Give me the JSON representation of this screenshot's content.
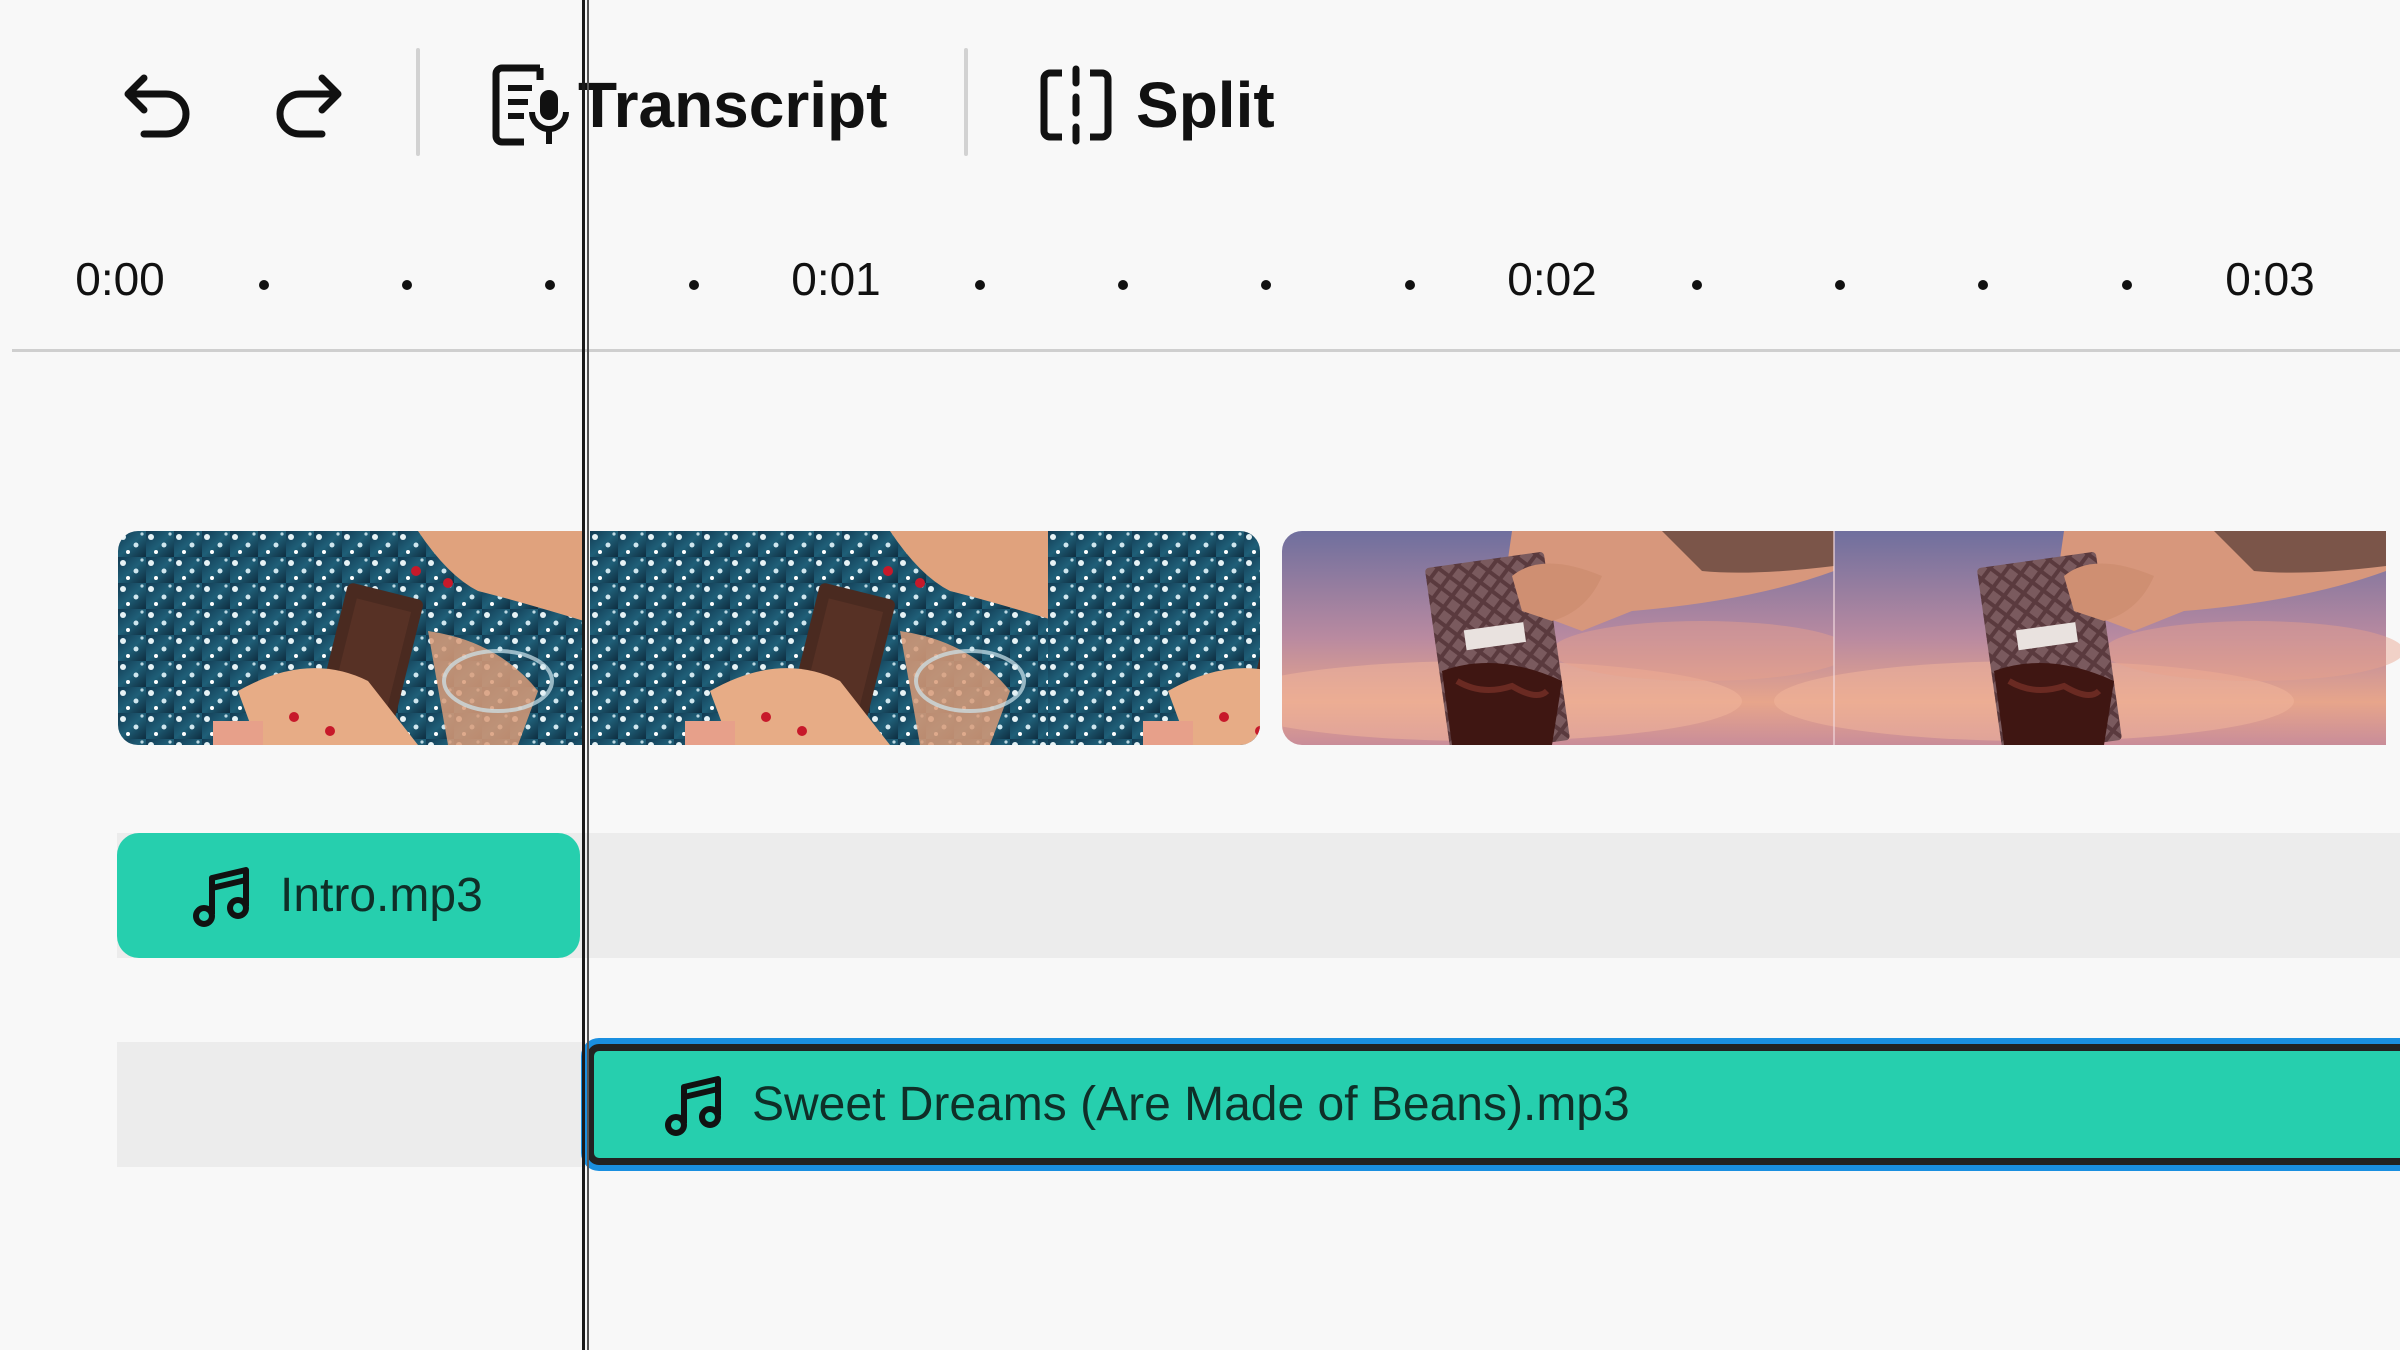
{
  "toolbar": {
    "undo_icon": "undo-icon",
    "redo_icon": "redo-icon",
    "transcript_label": "Transcript",
    "transcript_icon": "transcript-icon",
    "split_label": "Split",
    "split_icon": "split-icon"
  },
  "ruler": {
    "labels": [
      "0:00",
      "0:01",
      "0:02",
      "0:03"
    ]
  },
  "tracks": {
    "video_clips": [
      {
        "name": "jewels-chocolate-clip",
        "scene": "hands holding chocolate bar among jewels"
      },
      {
        "name": "sunset-chocolate-clip",
        "scene": "hand holding Moiré chocolate bar against sunset sky"
      }
    ],
    "audio_intro": {
      "label": "Intro.mp3",
      "icon": "music-note-icon"
    },
    "audio_sweet": {
      "label": "Sweet Dreams (Are Made of Beans).mp3",
      "icon": "music-note-icon"
    }
  },
  "colors": {
    "audio_clip": "#26cfae",
    "selection": "#1a8fe0",
    "lane": "#ececec",
    "background": "#f8f8f8"
  }
}
